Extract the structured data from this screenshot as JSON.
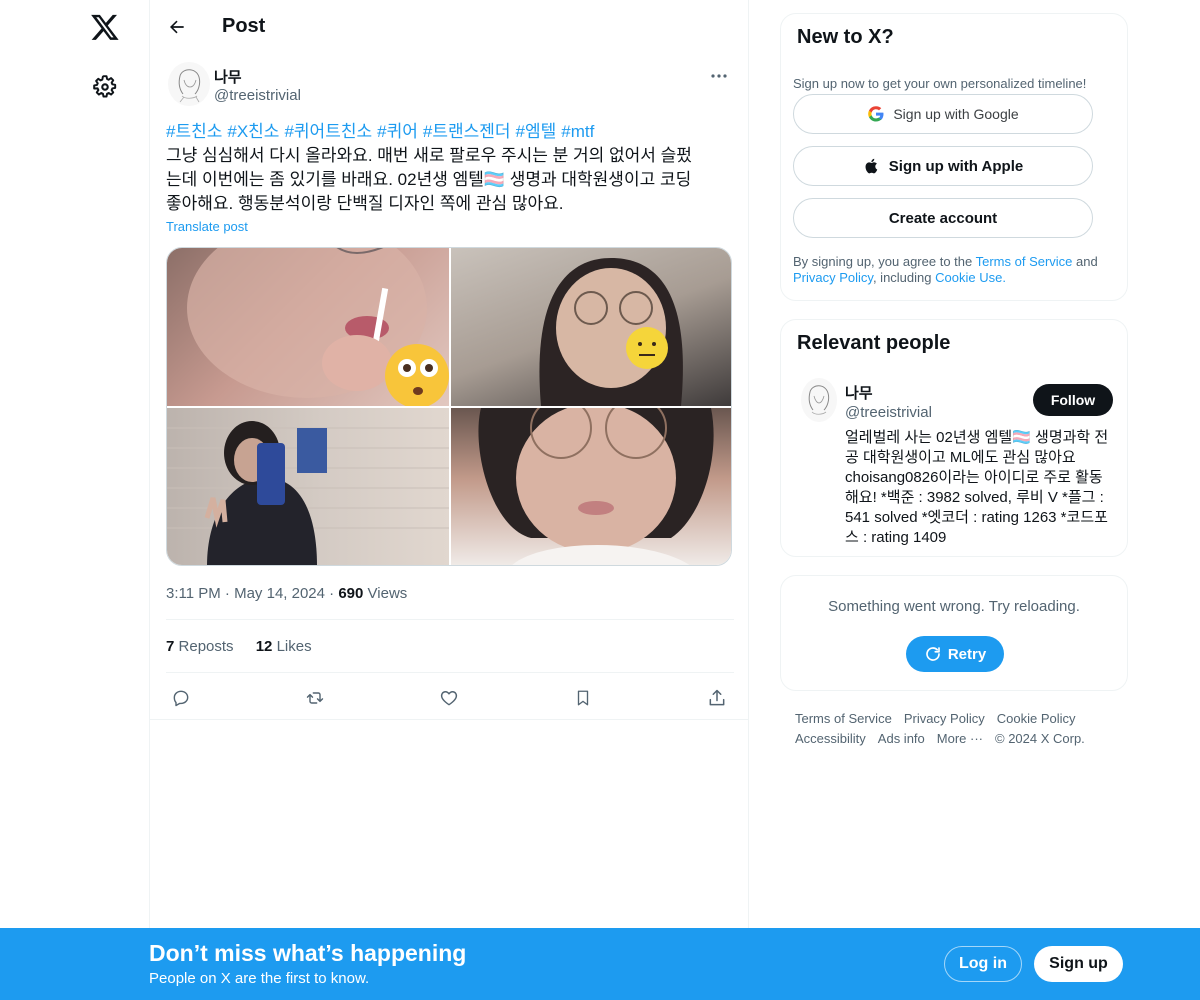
{
  "colors": {
    "accent": "#1d9bf0",
    "text": "#0f1419",
    "muted": "#536471",
    "border": "#eff3f4"
  },
  "nav": {
    "logo_icon": "x-logo-icon",
    "settings_icon": "gear-icon"
  },
  "header": {
    "back_icon": "arrow-left-icon",
    "title": "Post"
  },
  "post": {
    "author": {
      "name": "나무",
      "handle": "@treeistrivial"
    },
    "more_icon": "more-horizontal-icon",
    "hashtags": [
      "#트친소",
      "#X친소",
      "#퀴어트친소",
      "#퀴어",
      "#트랜스젠더",
      "#엠텔",
      "#mtf"
    ],
    "body_lines": [
      "그냥 심심해서 다시 올라와요. 매번 새로 팔로우 주시는 분 거의 없어서 슬펐",
      "는데 이번에는 좀 있기를 바래요. 02년생 엠텔🏳️‍⚧️ 생명과 대학원생이고 코딩",
      "좋아해요. 행동분석이랑 단백질 디자인 쪽에 관심 많아요."
    ],
    "translate": "Translate post",
    "media_count": 4,
    "time": "3:11 PM",
    "date": "May 14, 2024",
    "views_count": "690",
    "views_label": "Views",
    "reposts_count": "7",
    "reposts_label": "Reposts",
    "likes_count": "12",
    "likes_label": "Likes",
    "action_icons": [
      "reply-icon",
      "repost-icon",
      "like-icon",
      "bookmark-icon",
      "share-icon"
    ]
  },
  "signup_card": {
    "title": "New to X?",
    "subtitle": "Sign up now to get your own personalized timeline!",
    "google_label": "Sign up with Google",
    "apple_label": "Sign up with Apple",
    "create_label": "Create account",
    "legal_prefix": "By signing up, you agree to the ",
    "terms_link": "Terms of Service",
    "and": " and",
    "privacy_link": "Privacy Policy",
    "including": ", including ",
    "cookie_link": "Cookie Use",
    "period": "."
  },
  "relevant": {
    "title": "Relevant people",
    "name": "나무",
    "handle": "@treeistrivial",
    "follow_label": "Follow",
    "bio": "얼레벌레 사는 02년생 엠텔🏳️‍⚧️ 생명과학 전공 대학원생이고 ML에도 관심 많아요 choisang0826이라는 아이디로 주로 활동해요! *백준 : 3982 solved, 루비 V *플그 : 541 solved *엣코더 : rating 1263 *코드포스 : rating 1409"
  },
  "error_card": {
    "message": "Something went wrong. Try reloading.",
    "retry_label": "Retry"
  },
  "footer": {
    "links": [
      "Terms of Service",
      "Privacy Policy",
      "Cookie Policy",
      "Accessibility",
      "Ads info",
      "More ···"
    ],
    "copyright": "© 2024 X Corp."
  },
  "bottom_bar": {
    "title": "Don’t miss what’s happening",
    "subtitle": "People on X are the first to know.",
    "login_label": "Log in",
    "signup_label": "Sign up"
  }
}
